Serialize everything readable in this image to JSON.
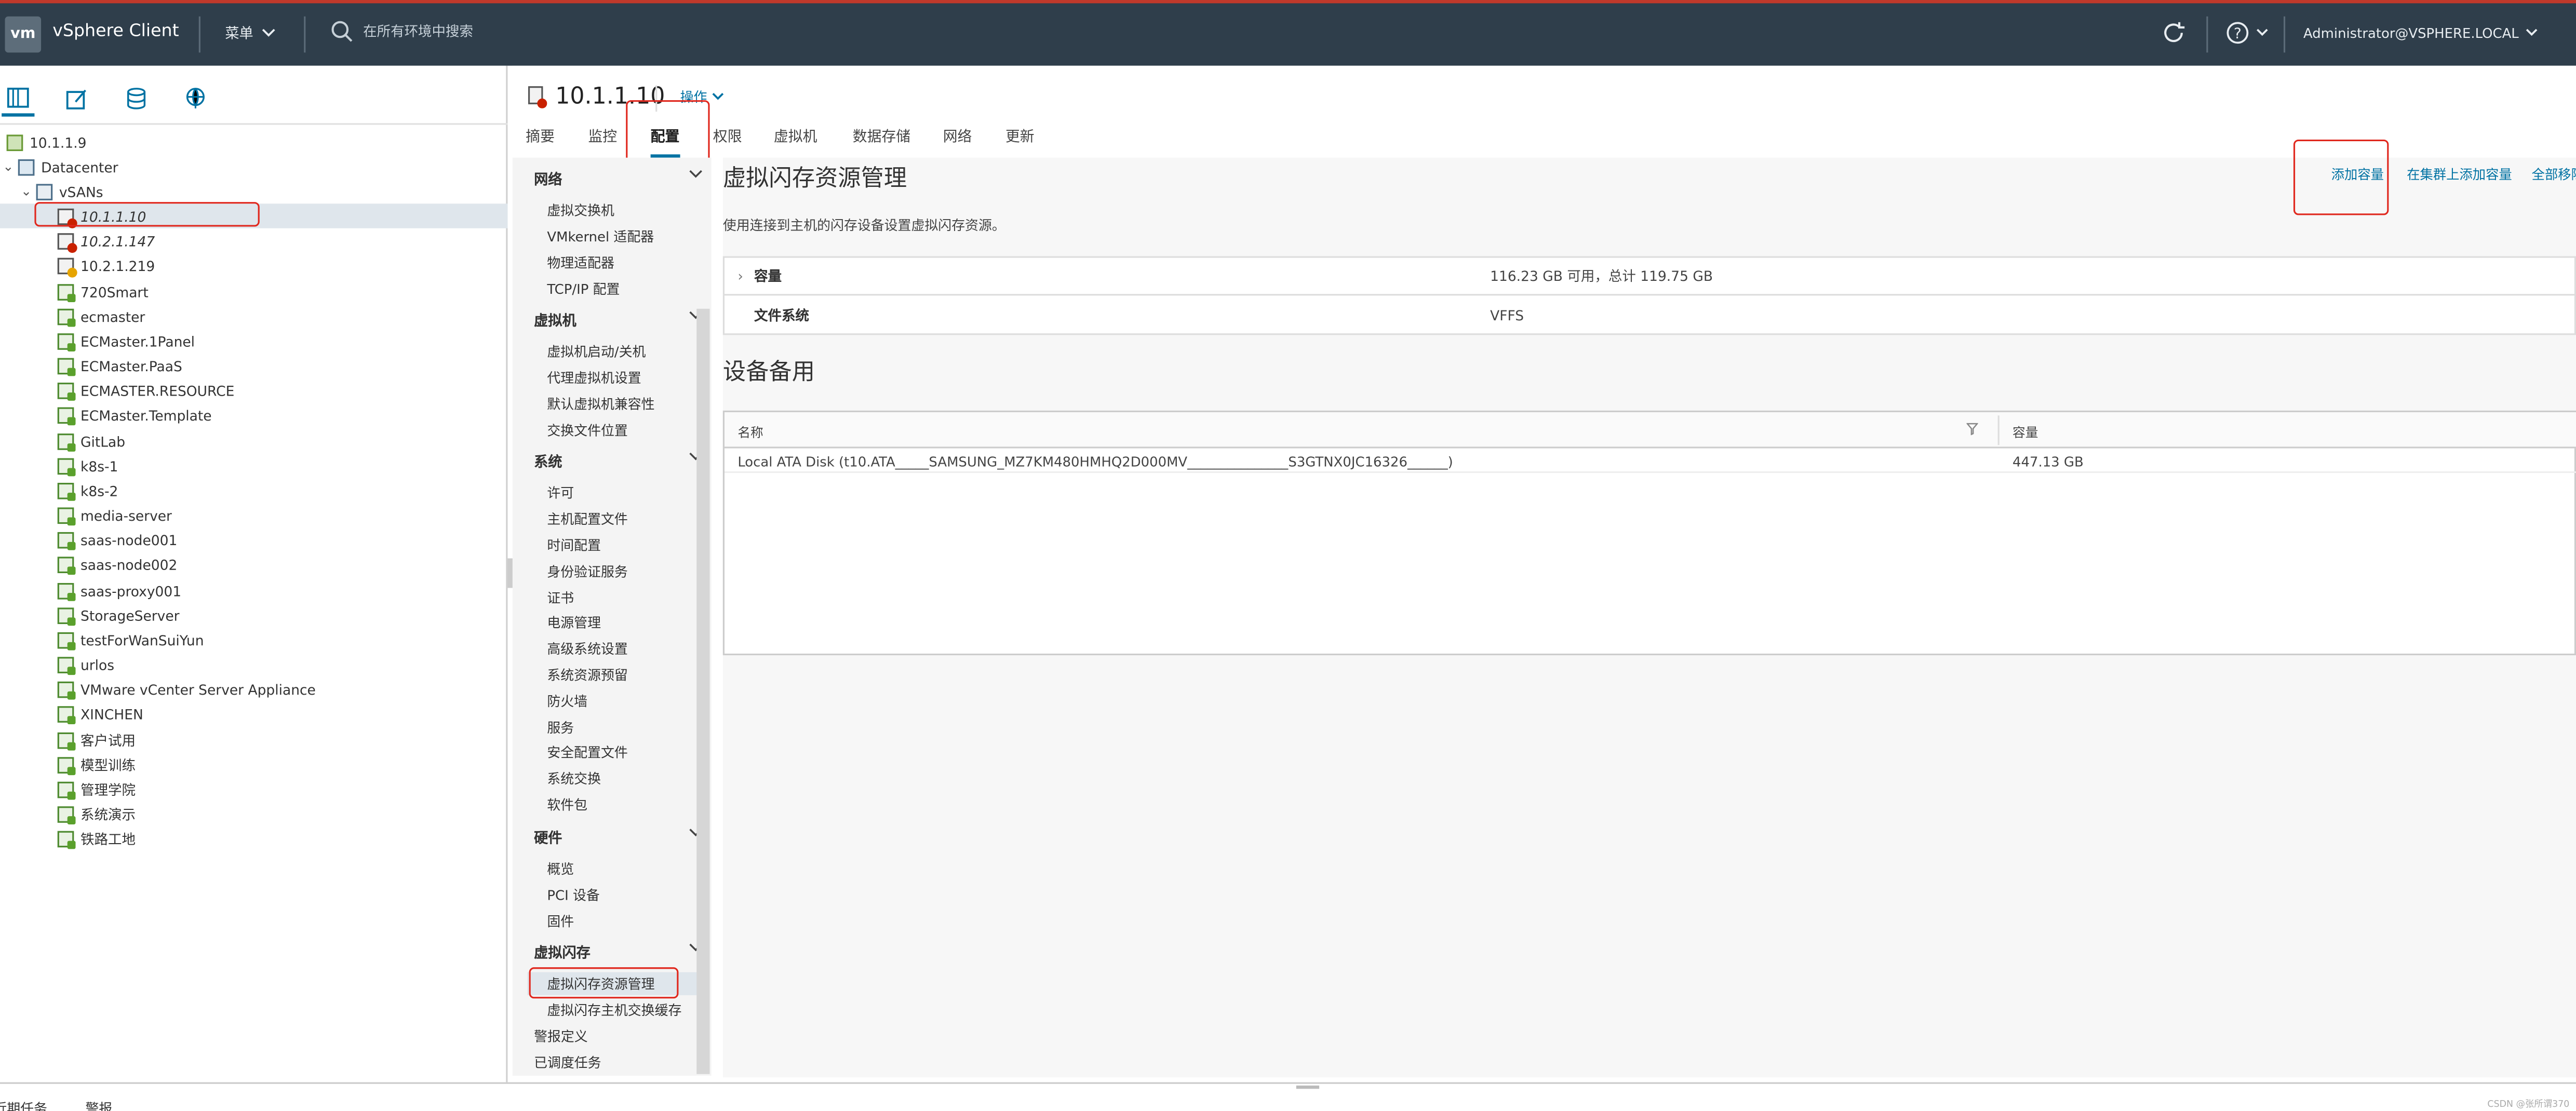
{
  "header": {
    "logo": "vm",
    "app_title": "vSphere Client",
    "menu_label": "菜单",
    "search_placeholder": "在所有环境中搜索",
    "user": "Administrator@VSPHERE.LOCAL",
    "icons": [
      "refresh-icon",
      "help-icon",
      "chevron-down-icon",
      "search-icon"
    ]
  },
  "nav_tabs": [
    "hosts-and-clusters-icon",
    "vms-and-templates-icon",
    "storage-icon",
    "networking-icon"
  ],
  "tree": [
    {
      "label": "10.1.1.9",
      "type": "vcenter",
      "level": 0
    },
    {
      "label": "Datacenter",
      "type": "datacenter",
      "level": 0,
      "expanded": true
    },
    {
      "label": "vSANs",
      "type": "cluster",
      "level": 1,
      "expanded": true
    },
    {
      "label": "10.1.1.10",
      "type": "host-error",
      "level": 2,
      "selected": true,
      "italic": true
    },
    {
      "label": "10.2.1.147",
      "type": "host-error",
      "level": 2,
      "italic": true
    },
    {
      "label": "10.2.1.219",
      "type": "host-warning",
      "level": 2
    },
    {
      "label": "720Smart",
      "type": "vm",
      "level": 2
    },
    {
      "label": "ecmaster",
      "type": "vm",
      "level": 2
    },
    {
      "label": "ECMaster.1Panel",
      "type": "vm",
      "level": 2
    },
    {
      "label": "ECMaster.PaaS",
      "type": "vm",
      "level": 2
    },
    {
      "label": "ECMASTER.RESOURCE",
      "type": "vm",
      "level": 2
    },
    {
      "label": "ECMaster.Template",
      "type": "vm",
      "level": 2
    },
    {
      "label": "GitLab",
      "type": "vm",
      "level": 2
    },
    {
      "label": "k8s-1",
      "type": "vm",
      "level": 2
    },
    {
      "label": "k8s-2",
      "type": "vm",
      "level": 2
    },
    {
      "label": "media-server",
      "type": "vm",
      "level": 2
    },
    {
      "label": "saas-node001",
      "type": "vm",
      "level": 2
    },
    {
      "label": "saas-node002",
      "type": "vm",
      "level": 2
    },
    {
      "label": "saas-proxy001",
      "type": "vm",
      "level": 2
    },
    {
      "label": "StorageServer",
      "type": "vm",
      "level": 2
    },
    {
      "label": "testForWanSuiYun",
      "type": "vm",
      "level": 2
    },
    {
      "label": "urlos",
      "type": "vm",
      "level": 2
    },
    {
      "label": "VMware vCenter Server Appliance",
      "type": "vm",
      "level": 2
    },
    {
      "label": "XINCHEN",
      "type": "vm",
      "level": 2
    },
    {
      "label": "客户试用",
      "type": "vm",
      "level": 2
    },
    {
      "label": "模型训练",
      "type": "vm",
      "level": 2
    },
    {
      "label": "管理学院",
      "type": "vm",
      "level": 2
    },
    {
      "label": "系统演示",
      "type": "vm",
      "level": 2
    },
    {
      "label": "铁路工地",
      "type": "vm",
      "level": 2
    }
  ],
  "host": {
    "title": "10.1.1.10",
    "actions_label": "操作",
    "tabs": [
      "摘要",
      "监控",
      "配置",
      "权限",
      "虚拟机",
      "数据存储",
      "网络",
      "更新"
    ],
    "active_tab": "配置"
  },
  "config_nav": {
    "sections": [
      {
        "title": "网络",
        "items": [
          "虚拟交换机",
          "VMkernel 适配器",
          "物理适配器",
          "TCP/IP 配置"
        ]
      },
      {
        "title": "虚拟机",
        "items": [
          "虚拟机启动/关机",
          "代理虚拟机设置",
          "默认虚拟机兼容性",
          "交换文件位置"
        ]
      },
      {
        "title": "系统",
        "items": [
          "许可",
          "主机配置文件",
          "时间配置",
          "身份验证服务",
          "证书",
          "电源管理",
          "高级系统设置",
          "系统资源预留",
          "防火墙",
          "服务",
          "安全配置文件",
          "系统交换",
          "软件包"
        ]
      },
      {
        "title": "硬件",
        "items": [
          "概览",
          "PCI 设备",
          "固件"
        ]
      },
      {
        "title": "虚拟闪存",
        "items": [
          "虚拟闪存资源管理",
          "虚拟闪存主机交换缓存"
        ]
      }
    ],
    "extra": [
      "警报定义",
      "已调度任务"
    ],
    "selected": "虚拟闪存资源管理"
  },
  "content": {
    "title": "虚拟闪存资源管理",
    "description": "使用连接到主机的闪存设备设置虚拟闪存资源。",
    "actions": [
      "添加容量",
      "在集群上添加容量",
      "全部移除"
    ],
    "capacity_label": "容量",
    "capacity_value": "116.23 GB 可用，总计 119.75 GB",
    "fs_label": "文件系统",
    "fs_value": "VFFS",
    "device_title": "设备备用",
    "grid": {
      "columns": [
        "名称",
        "容量"
      ],
      "rows": [
        {
          "name": "Local ATA Disk (t10.ATA_____SAMSUNG_MZ7KM480HMHQ2D000MV_______________S3GTNX0JC16326______)",
          "capacity": "447.13 GB"
        }
      ]
    }
  },
  "bottom": {
    "tabs": [
      "近期任务",
      "警报"
    ],
    "watermark": "CSDN @张所谓370"
  },
  "colors": {
    "topbar": "#2f3e4b",
    "accent": "#0072a3",
    "highlight_box": "#e0281e",
    "selection": "#dfe6ec"
  }
}
